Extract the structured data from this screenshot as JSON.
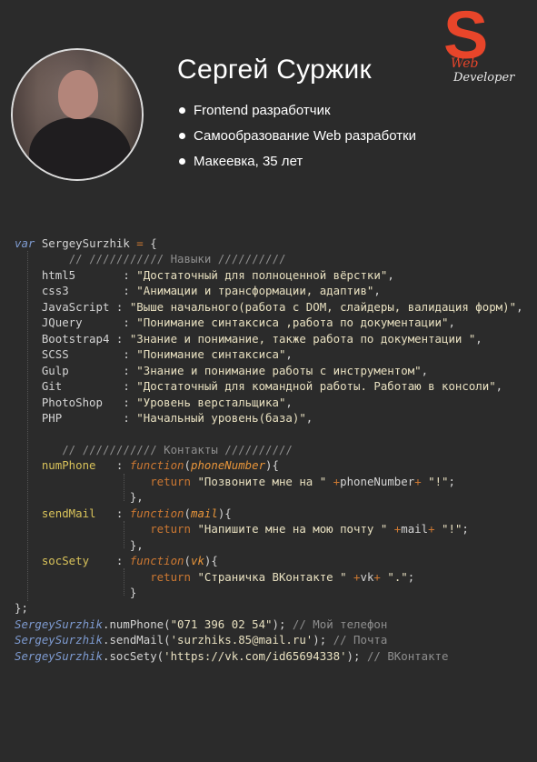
{
  "profile": {
    "name": "Сергей Суржик",
    "bullets": [
      "Frontend разработчик",
      "Самообразование Web разработки",
      "Макеевка, 35 лет"
    ]
  },
  "logo": {
    "letter": "S",
    "line1": "Web",
    "line2": "Developer"
  },
  "code": {
    "line1_kw": "var",
    "line1_name": " SergeySurzhik ",
    "line1_eq": "=",
    "line1_brace": " {",
    "skills_comment": "// /////////// Навыки //////////",
    "skills": [
      {
        "key": "html5      ",
        "value": "\"Достаточный для полноценной вёрстки\"",
        "end": ","
      },
      {
        "key": "css3       ",
        "value": "\"Анимации и трансформации, адаптив\"",
        "end": ","
      },
      {
        "key": "JavaScript",
        "value": "\"Выше начального(работа с DOM, слайдеры, валидация форм)\"",
        "end": ","
      },
      {
        "key": "JQuery     ",
        "value": "\"Понимание синтаксиса ,работа по документации\"",
        "end": ","
      },
      {
        "key": "Bootstrap4",
        "value": "\"Знание и понимание, также работа по документации \"",
        "end": ","
      },
      {
        "key": "SCSS       ",
        "value": "\"Понимание синтаксиса\"",
        "end": ","
      },
      {
        "key": "Gulp       ",
        "value": "\"Знание и понимание работы с инструментом\"",
        "end": ","
      },
      {
        "key": "Git        ",
        "value": "\"Достаточный для командной работы. Работаю в консоли\"",
        "end": ","
      },
      {
        "key": "PhotoShop  ",
        "value": "\"Уровень верстальщика\"",
        "end": ","
      },
      {
        "key": "PHP        ",
        "value": "\"Начальный уровень(база)\"",
        "end": ","
      }
    ],
    "contacts_comment": "// /////////// Контакты //////////",
    "contacts": [
      {
        "key": "numPhone ",
        "param": "phoneNumber",
        "ret_str": "\"Позвоните мне на \"",
        "tail_str": "\"!\""
      },
      {
        "key": "sendMail ",
        "param": "mail",
        "ret_str": "\"Напишите мне на мою почту \"",
        "tail_str": "\"!\""
      },
      {
        "key": "socSety  ",
        "param": "vk",
        "ret_str": "\"Страничка ВКонтакте \"",
        "tail_str": "\".\""
      }
    ],
    "function_kw": "function",
    "return_kw": "return",
    "close_obj": "};",
    "calls": [
      {
        "obj": "SergeySurzhik",
        "method": ".numPhone(",
        "arg": "\"071 396 02 54\"",
        "end": "); ",
        "comment": "// Мой телефон"
      },
      {
        "obj": "SergeySurzhik",
        "method": ".sendMail(",
        "arg": "'surzhiks.85@mail.ru'",
        "end": "); ",
        "comment": "// Почта"
      },
      {
        "obj": "SergeySurzhik",
        "method": ".socSety(",
        "arg": "'https://vk.com/id65694338'",
        "end": "); ",
        "comment": "// ВКонтакте"
      }
    ]
  },
  "colors": {
    "background": "#2b2b2b",
    "accent": "#e8452a",
    "keyword": "#7e9bd1",
    "function": "#cc7832",
    "comment": "#8e8e8e"
  }
}
